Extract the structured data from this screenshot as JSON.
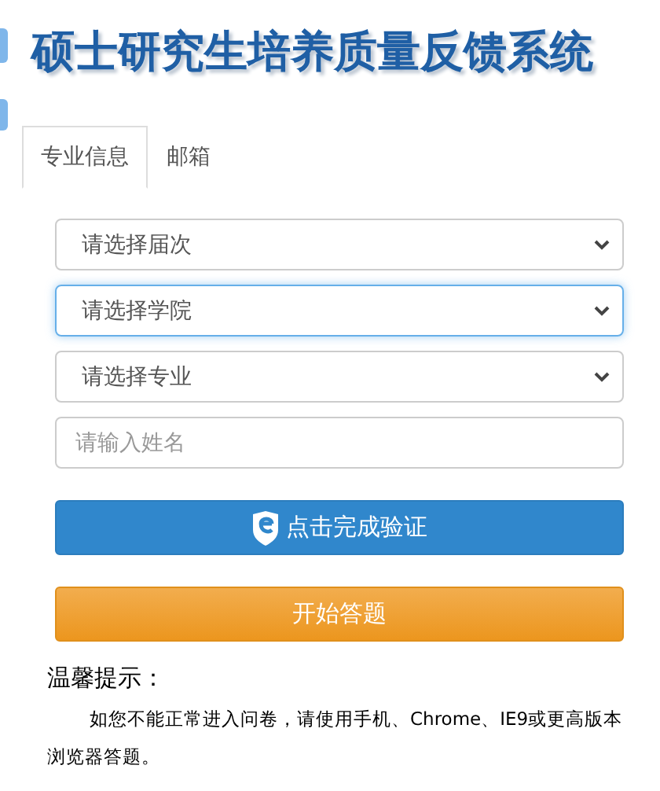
{
  "header": {
    "title": "硕士研究生培养质量反馈系统"
  },
  "tabs": [
    {
      "label": "专业信息",
      "selected": true
    },
    {
      "label": "邮箱",
      "selected": false
    }
  ],
  "form": {
    "dropdowns": [
      {
        "placeholder": "请选择届次",
        "focused": false
      },
      {
        "placeholder": "请选择学院",
        "focused": true
      },
      {
        "placeholder": "请选择专业",
        "focused": false
      }
    ],
    "name_field": {
      "placeholder": "请输入姓名"
    },
    "verify_button": {
      "label": "点击完成验证"
    },
    "start_button": {
      "label": "开始答题"
    }
  },
  "tip": {
    "heading": "温馨提示：",
    "text": "如您不能正常进入问卷，请使用手机、Chrome、IE9或更高版本浏览器答题。"
  }
}
